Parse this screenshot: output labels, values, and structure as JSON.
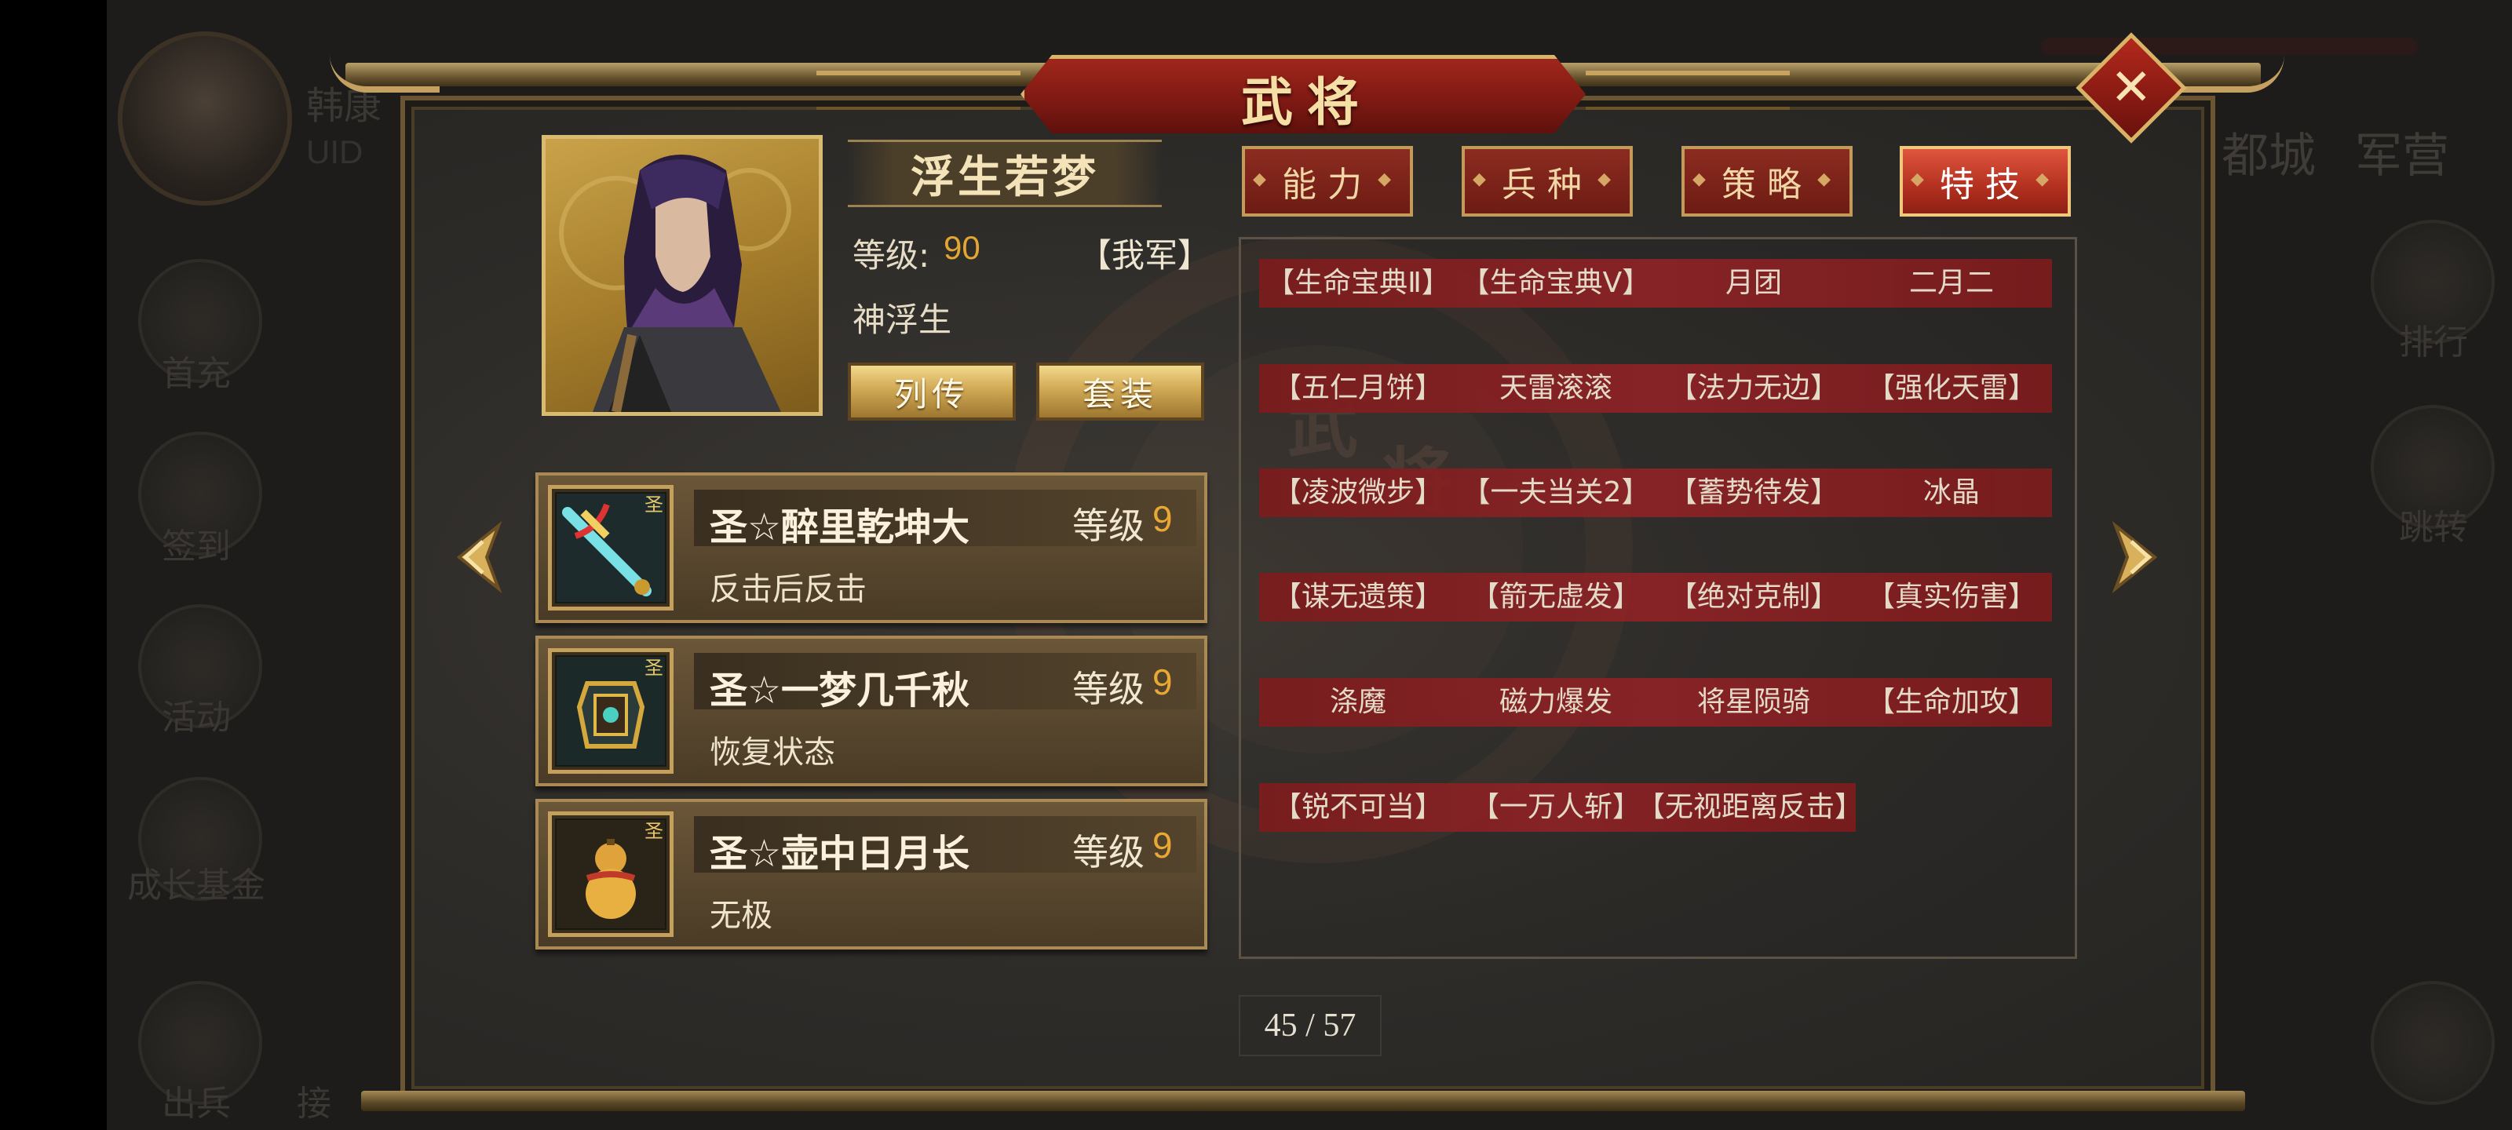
{
  "background": {
    "player_name": "韩康",
    "uid_label": "UID",
    "left_menu": [
      {
        "label": "首充",
        "icon": "gift-icon"
      },
      {
        "label": "签到",
        "icon": "calendar-icon"
      },
      {
        "label": "活动",
        "icon": "event-icon"
      },
      {
        "label": "成长基金",
        "icon": "fund-icon"
      },
      {
        "label": "出兵",
        "icon": "troops-icon"
      },
      {
        "label": "接"
      }
    ],
    "top_menu": [
      "都城",
      "军营"
    ],
    "right_menu": [
      {
        "label": "排行",
        "icon": "ranking-icon"
      },
      {
        "label": "跳转",
        "icon": "jump-icon"
      }
    ]
  },
  "dialog": {
    "title": "武将",
    "close_icon": "close-icon"
  },
  "hero": {
    "name": "浮生若梦",
    "level_label": "等级:",
    "level_value": "90",
    "faction": "【我军】",
    "subname": "神浮生",
    "bio_button": "列传",
    "set_button": "套装"
  },
  "equipment": [
    {
      "name": "圣☆醉里乾坤大",
      "level_label": "等级",
      "level": "9",
      "effect": "反击后反击",
      "icon": "sword-icon"
    },
    {
      "name": "圣☆一梦几千秋",
      "level_label": "等级",
      "level": "9",
      "effect": "恢复状态",
      "icon": "armor-icon"
    },
    {
      "name": "圣☆壶中日月长",
      "level_label": "等级",
      "level": "9",
      "effect": "无极",
      "icon": "gourd-icon"
    }
  ],
  "tabs": [
    {
      "label": "能力",
      "active": false
    },
    {
      "label": "兵种",
      "active": false
    },
    {
      "label": "策略",
      "active": false
    },
    {
      "label": "特技",
      "active": true
    }
  ],
  "skills": [
    [
      "【生命宝典Ⅱ】",
      "【生命宝典Ⅴ】",
      "月团",
      "二月二"
    ],
    [
      "【五仁月饼】",
      "天雷滚滚",
      "【法力无边】",
      "【强化天雷】"
    ],
    [
      "【凌波微步】",
      "【一夫当关2】",
      "【蓄势待发】",
      "冰晶"
    ],
    [
      "【谋无遗策】",
      "【箭无虚发】",
      "【绝对克制】",
      "【真实伤害】"
    ],
    [
      "涤魔",
      "磁力爆发",
      "将星陨骑",
      "【生命加攻】"
    ],
    [
      "【锐不可当】",
      "【一万人斩】",
      "【无视距离反击】"
    ]
  ],
  "pagination": {
    "current": "45",
    "total": "57",
    "text": "45 / 57"
  },
  "colors": {
    "accent_red": "#8e2327",
    "gold": "#d1a955",
    "level_orange": "#e9a733"
  }
}
